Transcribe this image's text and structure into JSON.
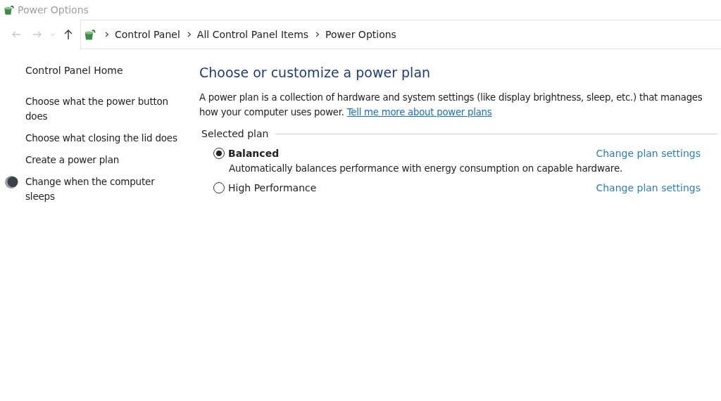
{
  "window": {
    "title": "Power Options"
  },
  "nav_buttons": [
    {
      "kind": "back",
      "disabled": true
    },
    {
      "kind": "forward",
      "disabled": true
    },
    {
      "kind": "recent",
      "disabled": true
    },
    {
      "kind": "up",
      "disabled": false
    }
  ],
  "breadcrumb": [
    "Control Panel",
    "All Control Panel Items",
    "Power Options"
  ],
  "sidebar": {
    "home": "Control Panel Home",
    "items": [
      {
        "label": "Choose what the power button does",
        "kind": "plain"
      },
      {
        "label": "Choose what closing the lid does",
        "kind": "plain"
      },
      {
        "label": "Create a power plan",
        "kind": "plain"
      },
      {
        "label": "Change when the computer sleeps",
        "kind": "moon"
      }
    ]
  },
  "main": {
    "heading": "Choose or customize a power plan",
    "intro": "A power plan is a collection of hardware and system settings (like display brightness, sleep, etc.) that manages how your computer uses power.",
    "intro_link": "Tell me more about power plans",
    "group_label": "Selected plan",
    "plans": [
      {
        "name": "Balanced",
        "selected": true,
        "description": "Automatically balances performance with energy consumption on capable hardware.",
        "action": "Change plan settings"
      },
      {
        "name": "High Performance",
        "selected": false,
        "action": "Change plan settings"
      }
    ]
  }
}
